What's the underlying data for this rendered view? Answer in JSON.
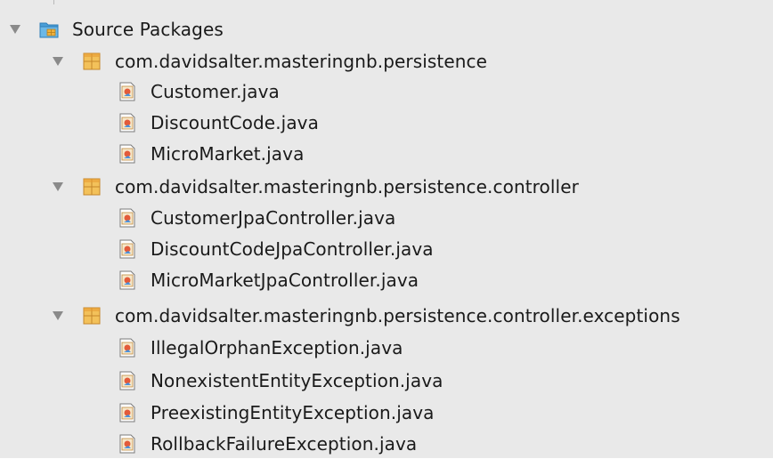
{
  "tree": {
    "root": {
      "label": "Source Packages",
      "icon": "source-folder-icon",
      "expanded": true
    },
    "packages": [
      {
        "label": "com.davidsalter.masteringnb.persistence",
        "icon": "package-icon",
        "expanded": true,
        "files": [
          "Customer.java",
          "DiscountCode.java",
          "MicroMarket.java"
        ]
      },
      {
        "label": "com.davidsalter.masteringnb.persistence.controller",
        "icon": "package-icon",
        "expanded": true,
        "files": [
          "CustomerJpaController.java",
          "DiscountCodeJpaController.java",
          "MicroMarketJpaController.java"
        ]
      },
      {
        "label": "com.davidsalter.masteringnb.persistence.controller.exceptions",
        "icon": "package-icon",
        "expanded": true,
        "files": [
          "IllegalOrphanException.java",
          "NonexistentEntityException.java",
          "PreexistingEntityException.java",
          "RollbackFailureException.java"
        ]
      }
    ],
    "file_icon": "java-file-icon",
    "colors": {
      "background": "#e9e9e9",
      "text": "#1a1a1a",
      "folder_blue": "#4a9fd8",
      "package_orange": "#e9a63c",
      "arrow": "#8a8a8a"
    }
  }
}
